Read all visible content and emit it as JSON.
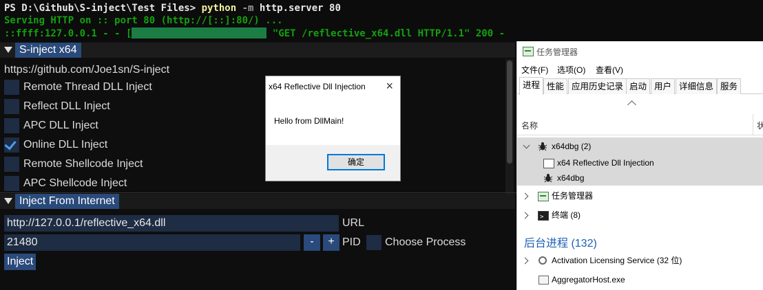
{
  "terminal": {
    "line1_prompt": "PS D:\\Github\\S-inject\\Test Files> ",
    "line1_cmd": "python",
    "line1_flag": " -m ",
    "line1_rest": "http.server 80",
    "line2": "Serving HTTP on :: port 80 (http://[::]:80/) ...",
    "line3_pre": "::ffff:127.0.0.1 - - [",
    "line3_post": " \"GET /reflective_x64.dll HTTP/1.1\" 200 -"
  },
  "imgui": {
    "title": "S-inject x64",
    "link": "https://github.com/Joe1sn/S-inject",
    "options": [
      {
        "label": "Remote Thread DLL Inject",
        "checked": false
      },
      {
        "label": "Reflect DLL Inject",
        "checked": false
      },
      {
        "label": "APC DLL Inject",
        "checked": false
      },
      {
        "label": "Online DLL Inject",
        "checked": true
      },
      {
        "label": "Remote Shellcode Inject",
        "checked": false
      },
      {
        "label": "APC Shellcode Inject",
        "checked": false
      }
    ],
    "section_title": "Inject From Internet",
    "url_value": "http://127.0.0.1/reflective_x64.dll",
    "url_label": "URL",
    "pid_value": "21480",
    "minus": "-",
    "plus": "+",
    "pid_label": "PID",
    "choose_process": "Choose Process",
    "inject_button": "Inject"
  },
  "dialog": {
    "title": "x64 Reflective Dll Injection",
    "close": "×",
    "message": "Hello from DllMain!",
    "ok_button": "确定"
  },
  "taskmgr": {
    "title": "任务管理器",
    "menu": [
      "文件(F)",
      "选项(O)",
      "查看(V)"
    ],
    "tabs": [
      "进程",
      "性能",
      "应用历史记录",
      "启动",
      "用户",
      "详细信息",
      "服务"
    ],
    "col_name": "名称",
    "col_cut": "状",
    "group": {
      "name": "x64dbg (2)",
      "children": [
        "x64 Reflective Dll Injection",
        "x64dbg"
      ]
    },
    "apps": [
      "任务管理器",
      "终端 (8)"
    ],
    "background_header": "后台进程 (132)",
    "background": [
      "Activation Licensing Service (32 位)",
      "AggregatorHost.exe"
    ]
  }
}
